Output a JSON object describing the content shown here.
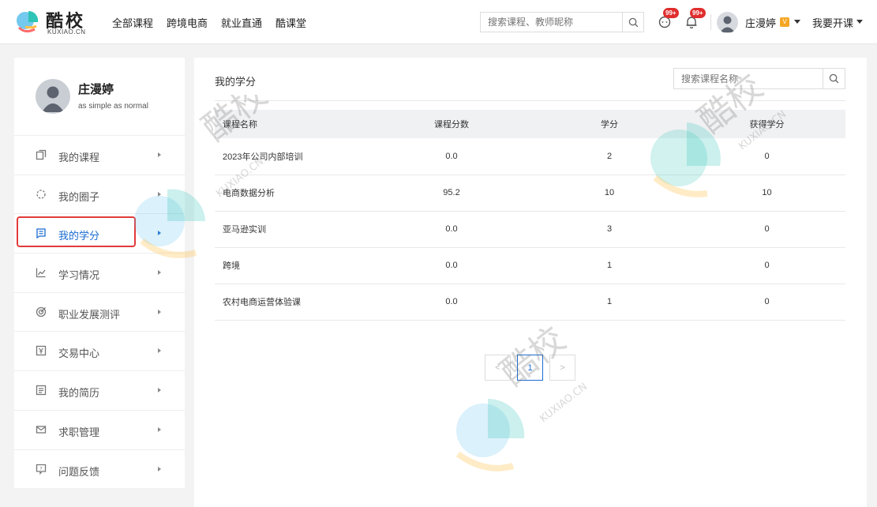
{
  "brand": {
    "name": "酷校",
    "sub": "KUXIAO.CN"
  },
  "nav": [
    "全部课程",
    "跨境电商",
    "就业直通",
    "酷课堂"
  ],
  "header": {
    "search_placeholder": "搜索课程、教师昵称",
    "chat_badge": "99+",
    "notice_badge": "99+",
    "username": "庄漫婷",
    "vip": "V",
    "open_course": "我要开课"
  },
  "profile": {
    "name": "庄漫婷",
    "bio": "as simple as normal"
  },
  "menu": [
    {
      "label": "我的课程",
      "icon": "course-icon"
    },
    {
      "label": "我的圈子",
      "icon": "circle-icon"
    },
    {
      "label": "我的学分",
      "icon": "credit-icon",
      "active": true
    },
    {
      "label": "学习情况",
      "icon": "chart-icon"
    },
    {
      "label": "职业发展测评",
      "icon": "target-icon"
    },
    {
      "label": "交易中心",
      "icon": "yen-icon"
    },
    {
      "label": "我的简历",
      "icon": "resume-icon"
    },
    {
      "label": "求职管理",
      "icon": "mail-icon"
    },
    {
      "label": "问题反馈",
      "icon": "feedback-icon"
    }
  ],
  "main": {
    "title": "我的学分",
    "search_placeholder": "搜索课程名称",
    "columns": [
      "课程名称",
      "课程分数",
      "学分",
      "获得学分"
    ],
    "rows": [
      [
        "2023年公司内部培训",
        "0.0",
        "2",
        "0"
      ],
      [
        "电商数据分析",
        "95.2",
        "10",
        "10"
      ],
      [
        "亚马逊实训",
        "0.0",
        "3",
        "0"
      ],
      [
        "跨境",
        "0.0",
        "1",
        "0"
      ],
      [
        "农村电商运营体验课",
        "0.0",
        "1",
        "0"
      ]
    ],
    "pager": {
      "prev": "<",
      "current": "1",
      "next": ">"
    }
  },
  "watermark": {
    "text": "酷校",
    "sub": "KUXIAO.CN"
  },
  "colors": {
    "accent": "#1a6bd1",
    "badge": "#e02d2d",
    "highlight": "#e23a3a"
  }
}
